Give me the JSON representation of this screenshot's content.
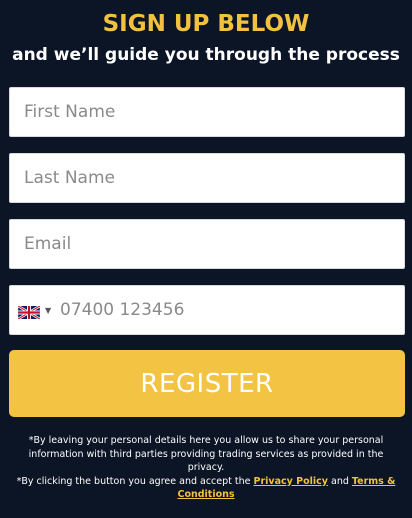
{
  "header": {
    "title": "SIGN UP BELOW",
    "subtitle": "and we’ll guide you through the process"
  },
  "form": {
    "first_name_placeholder": "First Name",
    "last_name_placeholder": "Last Name",
    "email_placeholder": "Email",
    "phone": {
      "country_flag": "uk-flag-icon",
      "placeholder": "07400 123456"
    },
    "register_label": "REGISTER"
  },
  "disclaimer": {
    "line1": "*By leaving your personal details here you allow us to share your personal information with third parties providing trading services as provided in the privacy.",
    "line2_prefix": "*By clicking the button you agree and accept the ",
    "privacy_policy_label": "Privacy Policy",
    "and_text": " and ",
    "terms_label": "Terms & Conditions"
  },
  "colors": {
    "background": "#0c1526",
    "accent": "#f3c140",
    "button": "#f3c443"
  }
}
